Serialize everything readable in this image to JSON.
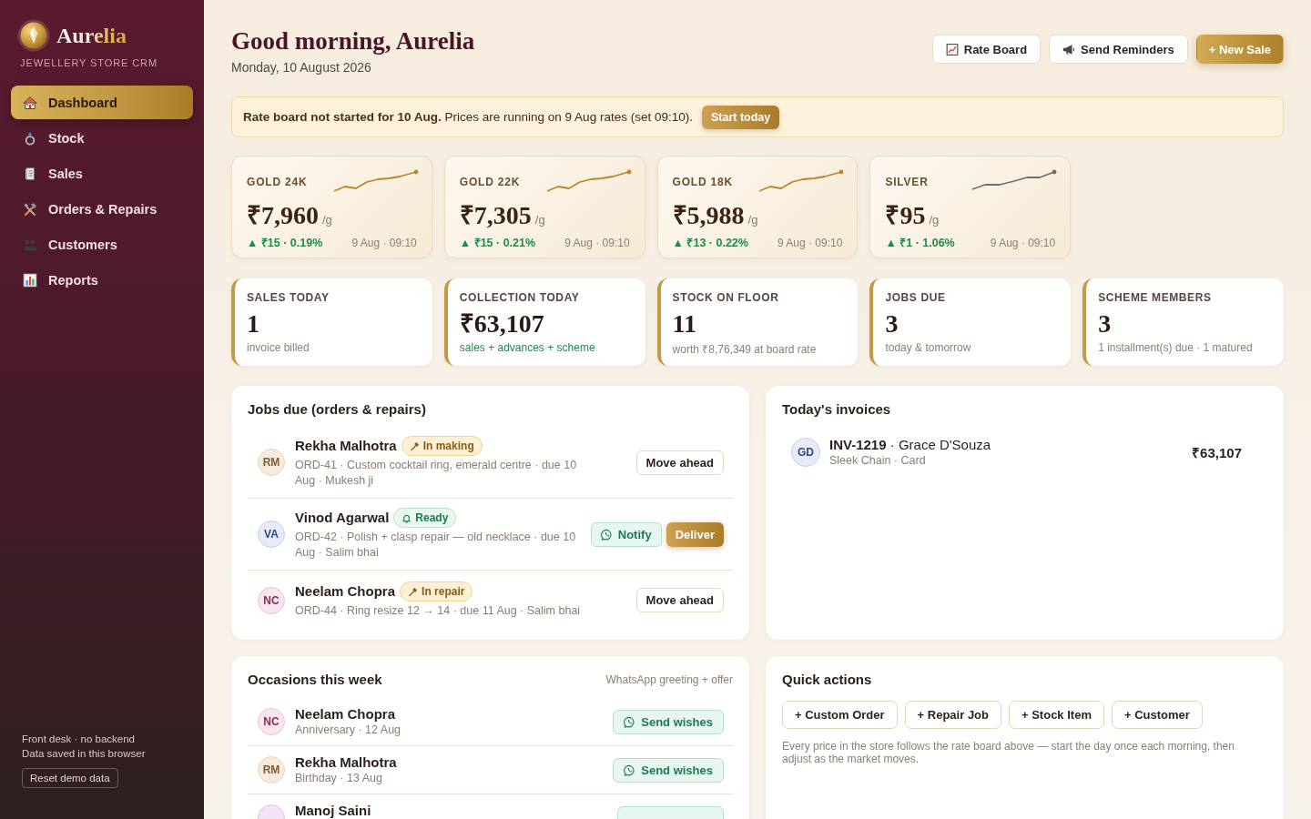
{
  "sidebar": {
    "brand": {
      "name": "Aurelia",
      "tagline": "JEWELLERY STORE CRM"
    },
    "nav": [
      {
        "label": "Dashboard",
        "selected": true
      },
      {
        "label": "Stock",
        "selected": false
      },
      {
        "label": "Sales",
        "selected": false
      },
      {
        "label": "Orders & Repairs",
        "selected": false
      },
      {
        "label": "Customers",
        "selected": false
      },
      {
        "label": "Reports",
        "selected": false
      }
    ],
    "footer": {
      "lines": [
        "Front desk · no backend",
        "Data saved in this browser"
      ],
      "button": "Reset demo data"
    }
  },
  "header": {
    "greeting": "Good morning, Aurelia",
    "date": "Monday, 10 August 2026",
    "buttons": [
      {
        "label": "Rate Board",
        "kind": "chart"
      },
      {
        "label": "Send Reminders",
        "kind": "megaphone"
      },
      {
        "label": "+ New Sale",
        "kind": "primary"
      }
    ]
  },
  "alert": {
    "text": "**Rate board not started for 10 Aug.** Prices are running on 9 Aug rates (set 09:10).",
    "button": "Start today"
  },
  "rates": [
    {
      "label": "GOLD 24K",
      "kind": "gold",
      "price": "₹7,960",
      "unit": "/g",
      "change": "▲ ₹15 · 0.19%",
      "time": "9 Aug · 09:10"
    },
    {
      "label": "GOLD 22K",
      "kind": "gold",
      "price": "₹7,305",
      "unit": "/g",
      "change": "▲ ₹15 · 0.21%",
      "time": "9 Aug · 09:10"
    },
    {
      "label": "GOLD 18K",
      "kind": "gold",
      "price": "₹5,988",
      "unit": "/g",
      "change": "▲ ₹13 · 0.22%",
      "time": "9 Aug · 09:10"
    },
    {
      "label": "SILVER",
      "kind": "silver",
      "price": "₹95",
      "unit": "/g",
      "change": "▲ ₹1 · 1.06%",
      "time": "9 Aug · 09:10"
    }
  ],
  "stats": [
    {
      "label": "SALES TODAY",
      "value": "1",
      "note": "invoice billed",
      "positive": false
    },
    {
      "label": "COLLECTION TODAY",
      "value": "₹63,107",
      "note": "sales + advances + scheme",
      "positive": true
    },
    {
      "label": "STOCK ON FLOOR",
      "value": "11",
      "note": "worth ₹8,76,349 at board rate",
      "positive": false
    },
    {
      "label": "JOBS DUE",
      "value": "3",
      "note": "today & tomorrow",
      "positive": false
    },
    {
      "label": "SCHEME MEMBERS",
      "value": "3",
      "note": "1 installment(s) due · 1 matured",
      "positive": false
    }
  ],
  "jobs": {
    "title": "Jobs due (orders & repairs)",
    "rows": [
      {
        "initials": "RM",
        "color": "#f6ebdf",
        "name": "Rekha Malhotra",
        "status": {
          "label": "In making",
          "kind": "working"
        },
        "detail": "ORD-41 · Custom cocktail ring, emerald centre · due 10 Aug · Mukesh ji",
        "actions": [
          {
            "label": "Move ahead",
            "kind": "outline"
          }
        ]
      },
      {
        "initials": "VA",
        "color": "#e7ebf7",
        "name": "Vinod Agarwal",
        "status": {
          "label": "Ready",
          "kind": "ready"
        },
        "detail": "ORD-42 · Polish + clasp repair — old necklace · due 10 Aug · Salim bhai",
        "actions": [
          {
            "label": "Notify",
            "kind": "whatsapp"
          },
          {
            "label": "Deliver",
            "kind": "primary"
          }
        ]
      },
      {
        "initials": "NC",
        "color": "#f8e5ee",
        "name": "Neelam Chopra",
        "status": {
          "label": "In repair",
          "kind": "working"
        },
        "detail": "ORD-44 · Ring resize 12 → 14 · due 11 Aug · Salim bhai",
        "actions": [
          {
            "label": "Move ahead",
            "kind": "outline"
          }
        ]
      }
    ]
  },
  "invoices": {
    "title": "Today's invoices",
    "rows": [
      {
        "initials": "GD",
        "color": "#e7ebf7",
        "title": "**INV-1219** · Grace D'Souza",
        "detail": "Sleek Chain · Card",
        "amount": "₹63,107"
      }
    ]
  },
  "occasions": {
    "title": "Occasions this week",
    "hint": "WhatsApp greeting + offer",
    "rows": [
      {
        "initials": "NC",
        "color": "#f8e5ee",
        "name": "Neelam Chopra",
        "detail": "Anniversary · 12 Aug",
        "button": "Send wishes"
      },
      {
        "initials": "RM",
        "color": "#f6ebdf",
        "name": "Rekha Malhotra",
        "detail": "Birthday · 13 Aug",
        "button": "Send wishes"
      },
      {
        "color": "#f1e4f6",
        "name": "Manoj Saini"
      }
    ]
  },
  "quick_actions": {
    "title": "Quick actions",
    "buttons": [
      "+ Custom Order",
      "+ Repair Job",
      "+ Stock Item",
      "+ Customer"
    ],
    "note": "Every price in the store follows the rate board above — start the day once each morning, then adjust as the market moves."
  }
}
